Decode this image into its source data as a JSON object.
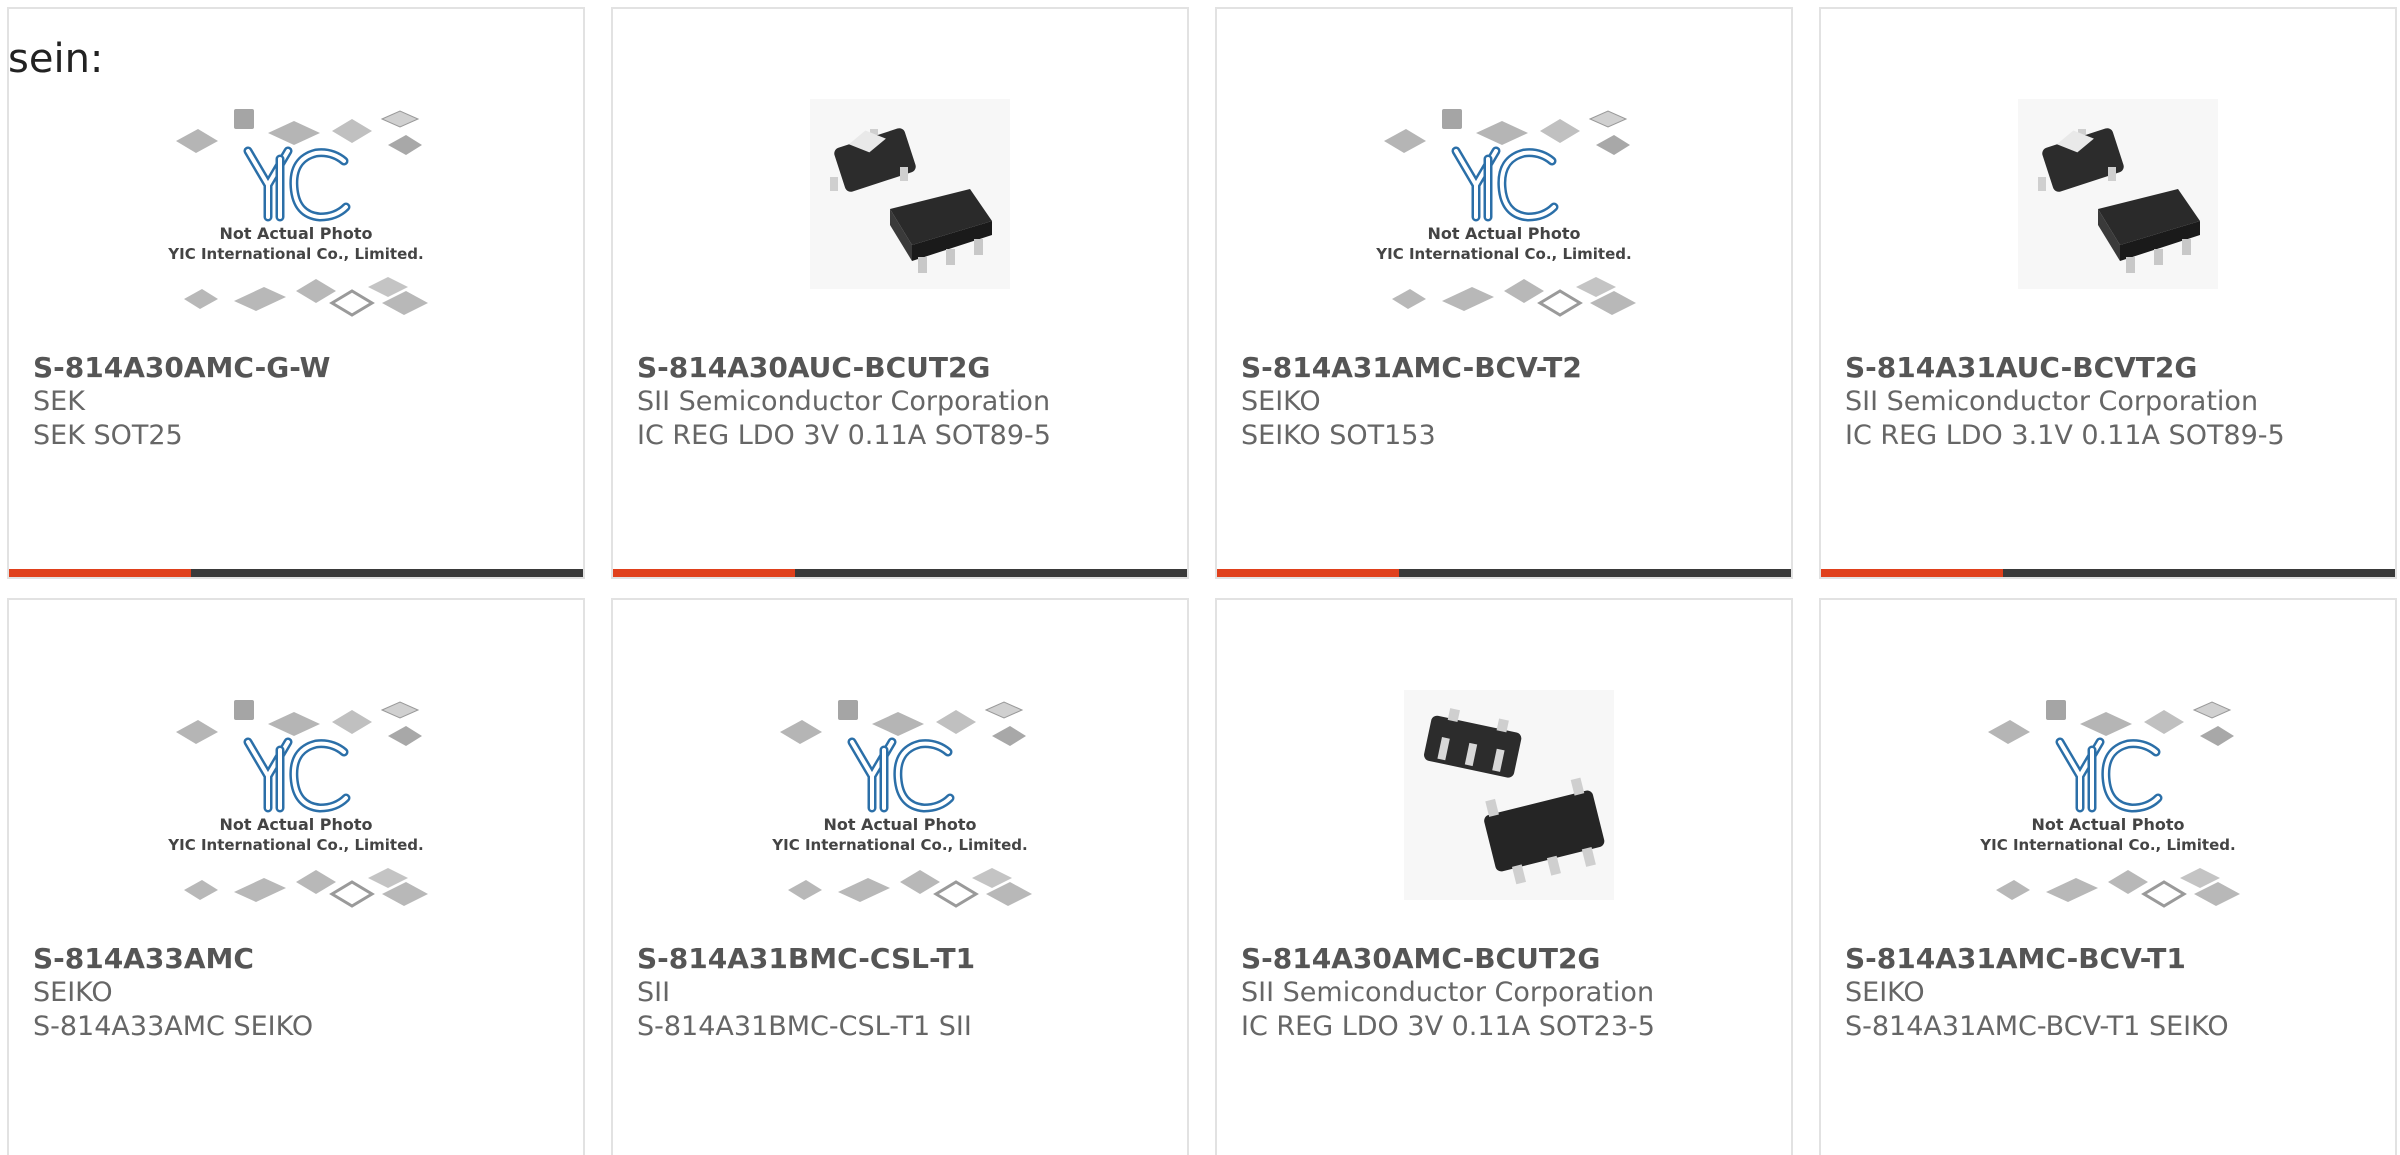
{
  "lead_text": "sein:",
  "colors": {
    "accent": "#e0401c",
    "bar": "#3a3a3a",
    "card_border": "#e2e2e2"
  },
  "placeholder": {
    "line1": "Not Actual Photo",
    "line2": "YIC International Co., Limited.",
    "logo_text": "YIC"
  },
  "products": [
    {
      "part": "S-814A30AMC-G-W",
      "manufacturer": "SEK",
      "description": "SEK SOT25",
      "image": "placeholder"
    },
    {
      "part": "S-814A30AUC-BCUT2G",
      "manufacturer": "SII Semiconductor Corporation",
      "description": "IC REG LDO 3V 0.11A SOT89-5",
      "image": "sot89-photo"
    },
    {
      "part": "S-814A31AMC-BCV-T2",
      "manufacturer": "SEIKO",
      "description": "SEIKO SOT153",
      "image": "placeholder"
    },
    {
      "part": "S-814A31AUC-BCVT2G",
      "manufacturer": "SII Semiconductor Corporation",
      "description": "IC REG LDO 3.1V 0.11A SOT89-5",
      "image": "sot89-photo"
    },
    {
      "part": "S-814A33AMC",
      "manufacturer": "SEIKO",
      "description": "S-814A33AMC SEIKO",
      "image": "placeholder"
    },
    {
      "part": "S-814A31BMC-CSL-T1",
      "manufacturer": "SII",
      "description": "S-814A31BMC-CSL-T1 SII",
      "image": "placeholder"
    },
    {
      "part": "S-814A30AMC-BCUT2G",
      "manufacturer": "SII Semiconductor Corporation",
      "description": "IC REG LDO 3V 0.11A SOT23-5",
      "image": "sot23-photo"
    },
    {
      "part": "S-814A31AMC-BCV-T1",
      "manufacturer": "SEIKO",
      "description": "S-814A31AMC-BCV-T1 SEIKO",
      "image": "placeholder"
    }
  ]
}
